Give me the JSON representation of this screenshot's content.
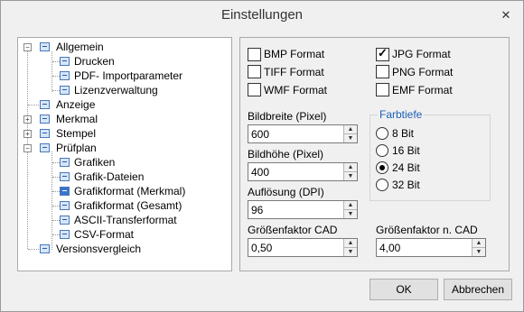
{
  "window": {
    "title": "Einstellungen",
    "close_glyph": "✕"
  },
  "tree": {
    "items": [
      {
        "label": "Allgemein",
        "level": 0,
        "expander": "−"
      },
      {
        "label": "Drucken",
        "level": 1
      },
      {
        "label": "PDF- Importparameter",
        "level": 1
      },
      {
        "label": "Lizenzverwaltung",
        "level": 1
      },
      {
        "label": "Anzeige",
        "level": 0
      },
      {
        "label": "Merkmal",
        "level": 0,
        "expander": "+"
      },
      {
        "label": "Stempel",
        "level": 0,
        "expander": "+"
      },
      {
        "label": "Prüfplan",
        "level": 0,
        "expander": "−"
      },
      {
        "label": "Grafiken",
        "level": 1
      },
      {
        "label": "Grafik-Dateien",
        "level": 1
      },
      {
        "label": "Grafikformat (Merkmal)",
        "level": 1,
        "selected": true
      },
      {
        "label": "Grafikformat (Gesamt)",
        "level": 1
      },
      {
        "label": "ASCII-Transferformat",
        "level": 1
      },
      {
        "label": "CSV-Format",
        "level": 1
      },
      {
        "label": "Versionsvergleich",
        "level": 0
      }
    ]
  },
  "formats": {
    "bmp": {
      "label": "BMP Format",
      "checked": false
    },
    "jpg": {
      "label": "JPG Format",
      "checked": true
    },
    "tiff": {
      "label": "TIFF Format",
      "checked": false
    },
    "png": {
      "label": "PNG Format",
      "checked": false
    },
    "wmf": {
      "label": "WMF Format",
      "checked": false
    },
    "emf": {
      "label": "EMF Format",
      "checked": false
    }
  },
  "fields": {
    "width_label": "Bildbreite (Pixel)",
    "width_value": "600",
    "height_label": "Bildhöhe (Pixel)",
    "height_value": "400",
    "dpi_label": "Auflösung (DPI)",
    "dpi_value": "96",
    "cad_label": "Größenfaktor CAD",
    "cad_value": "0,50",
    "ncad_label": "Größenfaktor n. CAD",
    "ncad_value": "4,00"
  },
  "farbtiefe": {
    "title": "Farbtiefe",
    "options": [
      {
        "label": "8 Bit",
        "selected": false
      },
      {
        "label": "16 Bit",
        "selected": false
      },
      {
        "label": "24 Bit",
        "selected": true
      },
      {
        "label": "32 Bit",
        "selected": false
      }
    ]
  },
  "buttons": {
    "ok": "OK",
    "cancel": "Abbrechen"
  }
}
